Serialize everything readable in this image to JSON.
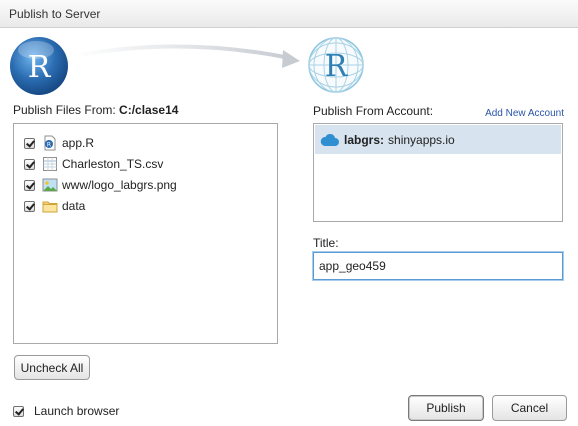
{
  "window": {
    "title": "Publish to Server"
  },
  "source": {
    "label": "Publish Files From:",
    "path": "C:/clase14",
    "files": [
      {
        "name": "app.R",
        "checked": true,
        "icon": "r-file-icon"
      },
      {
        "name": "Charleston_TS.csv",
        "checked": true,
        "icon": "csv-file-icon"
      },
      {
        "name": "www/logo_labgrs.png",
        "checked": true,
        "icon": "image-file-icon"
      },
      {
        "name": "data",
        "checked": true,
        "icon": "folder-icon"
      }
    ],
    "uncheck_all_label": "Uncheck All",
    "launch_browser_label": "Launch browser",
    "launch_browser_checked": true
  },
  "account": {
    "label": "Publish From Account:",
    "add_new_label": "Add New Account",
    "selected": {
      "name": "labgrs:",
      "server": "shinyapps.io"
    }
  },
  "title_field": {
    "label": "Title:",
    "value": "app_geo459"
  },
  "buttons": {
    "publish": "Publish",
    "cancel": "Cancel"
  },
  "colors": {
    "accent_blue": "#2a6bb0",
    "cloud_blue": "#2f8fd0",
    "selection": "#d7e3ee",
    "link": "#2a55a9"
  }
}
